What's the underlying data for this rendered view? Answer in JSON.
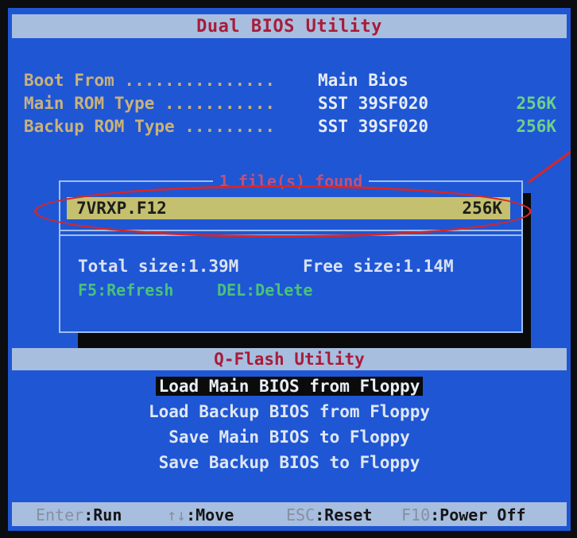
{
  "title": "Dual BIOS Utility",
  "info": [
    {
      "label": "Boot From ...............",
      "value": "Main Bios",
      "size": ""
    },
    {
      "label": "Main ROM Type ...........",
      "value": "SST 39SF020",
      "size": "256K"
    },
    {
      "label": "Backup ROM Type .........",
      "value": "SST 39SF020",
      "size": "256K"
    }
  ],
  "dialog": {
    "title": "1 file(s) found",
    "file": {
      "name": "7VRXP.F12",
      "size": "256K"
    },
    "total_size": "Total size:1.39M",
    "free_size": "Free size:1.14M",
    "action_refresh": "F5:Refresh",
    "action_delete": "DEL:Delete"
  },
  "qflash": {
    "title": "Q-Flash Utility",
    "items": [
      {
        "label": "Load Main BIOS from Floppy",
        "selected": true
      },
      {
        "label": "Load Backup BIOS from Floppy",
        "selected": false
      },
      {
        "label": "Save Main BIOS to Floppy",
        "selected": false
      },
      {
        "label": "Save Backup BIOS to Floppy",
        "selected": false
      }
    ]
  },
  "status": {
    "enter_key": "Enter",
    "enter_label": ":Run",
    "move_key": "↑↓",
    "move_label": ":Move",
    "esc_key": "ESC",
    "esc_label": ":Reset",
    "f10_key": "F10",
    "f10_label": ":Power Off"
  },
  "colors": {
    "background": "#1f56d4",
    "bar": "#a8bedf",
    "title_text": "#a81c3a",
    "highlight_file": "#c4c06f",
    "annotation": "#d72626"
  }
}
